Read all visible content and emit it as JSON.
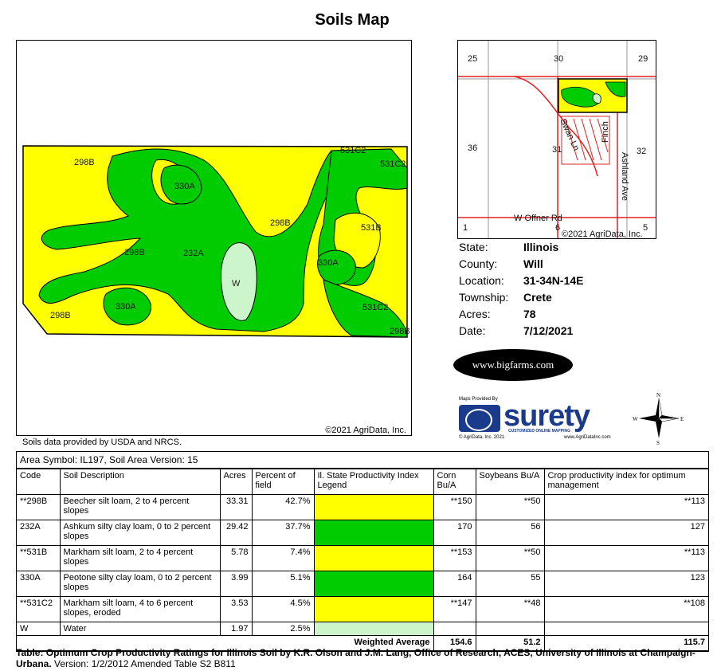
{
  "title": "Soils Map",
  "map": {
    "copyright": "©2021 AgriData, Inc.",
    "soil_labels": [
      "298B",
      "531C2",
      "531C2",
      "330A",
      "298B",
      "531B",
      "298B",
      "232A",
      "330A",
      "W",
      "330A",
      "531C2",
      "298B",
      "298B"
    ],
    "colors": {
      "yellow": "#ffff00",
      "green": "#00cc00",
      "light_green": "#ccf5cc"
    }
  },
  "locator": {
    "section_labels": [
      "25",
      "30",
      "29",
      "36",
      "31",
      "32",
      "1",
      "6",
      "5"
    ],
    "road_labels": [
      "Swan Ln",
      "Finch",
      "Ashland Ave",
      "W Offner Rd"
    ],
    "copyright": "©2021 AgriData, Inc."
  },
  "info": {
    "rows": [
      {
        "key": "State:",
        "value": "Illinois"
      },
      {
        "key": "County:",
        "value": "Will"
      },
      {
        "key": "Location:",
        "value": "31-34N-14E"
      },
      {
        "key": "Township:",
        "value": "Crete"
      },
      {
        "key": "Acres:",
        "value": "78"
      },
      {
        "key": "Date:",
        "value": "7/12/2021"
      }
    ]
  },
  "logos": {
    "bigfarms": "www.bigfarms.com",
    "surety_provided": "Maps Provided By",
    "surety_word": "surety",
    "surety_tag": "CUSTOMIZED ONLINE MAPPING",
    "surety_foot_left": "© AgriData, Inc. 2021",
    "surety_foot_right": "www.AgriDataInc.com",
    "compass": {
      "n": "N",
      "s": "S",
      "e": "E",
      "w": "W"
    }
  },
  "source_note": "Soils data provided by USDA and NRCS.",
  "table": {
    "area_symbol": "Area Symbol: IL197, Soil Area Version: 15",
    "headers": [
      "Code",
      "Soil Description",
      "Acres",
      "Percent of field",
      "Il. State Productivity Index Legend",
      "Corn Bu/A",
      "Soybeans Bu/A",
      "Crop productivity index for optimum management"
    ],
    "rows": [
      {
        "code": "**298B",
        "desc": "Beecher silt loam, 2 to 4 percent slopes",
        "acres": "33.31",
        "pct": "42.7%",
        "color": "#ffff00",
        "corn": "**150",
        "soy": "**50",
        "cpi": "**113"
      },
      {
        "code": "232A",
        "desc": "Ashkum silty clay loam, 0 to 2 percent slopes",
        "acres": "29.42",
        "pct": "37.7%",
        "color": "#00cc00",
        "corn": "170",
        "soy": "56",
        "cpi": "127"
      },
      {
        "code": "**531B",
        "desc": "Markham silt loam, 2 to 4 percent slopes",
        "acres": "5.78",
        "pct": "7.4%",
        "color": "#ffff00",
        "corn": "**153",
        "soy": "**50",
        "cpi": "**113"
      },
      {
        "code": "330A",
        "desc": "Peotone silty clay loam, 0 to 2 percent slopes",
        "acres": "3.99",
        "pct": "5.1%",
        "color": "#00cc00",
        "corn": "164",
        "soy": "55",
        "cpi": "123"
      },
      {
        "code": "**531C2",
        "desc": "Markham silt loam, 4 to 6 percent slopes, eroded",
        "acres": "3.53",
        "pct": "4.5%",
        "color": "#ffff00",
        "corn": "**147",
        "soy": "**48",
        "cpi": "**108"
      },
      {
        "code": "W",
        "desc": "Water",
        "acres": "1.97",
        "pct": "2.5%",
        "color": "#ccf5cc",
        "corn": "",
        "soy": "",
        "cpi": ""
      }
    ],
    "weighted_average": {
      "label": "Weighted Average",
      "corn": "154.6",
      "soy": "51.2",
      "cpi": "115.7"
    }
  },
  "footer": {
    "bold_text": "Table: Optimum Crop Productivity Ratings for Illinois Soil by K.R. Olson and J.M. Lang, Office of Research, ACES, University of Illinois at Champaign-Urbana.",
    "normal_text": " Version: 1/2/2012 Amended Table S2 B811"
  }
}
